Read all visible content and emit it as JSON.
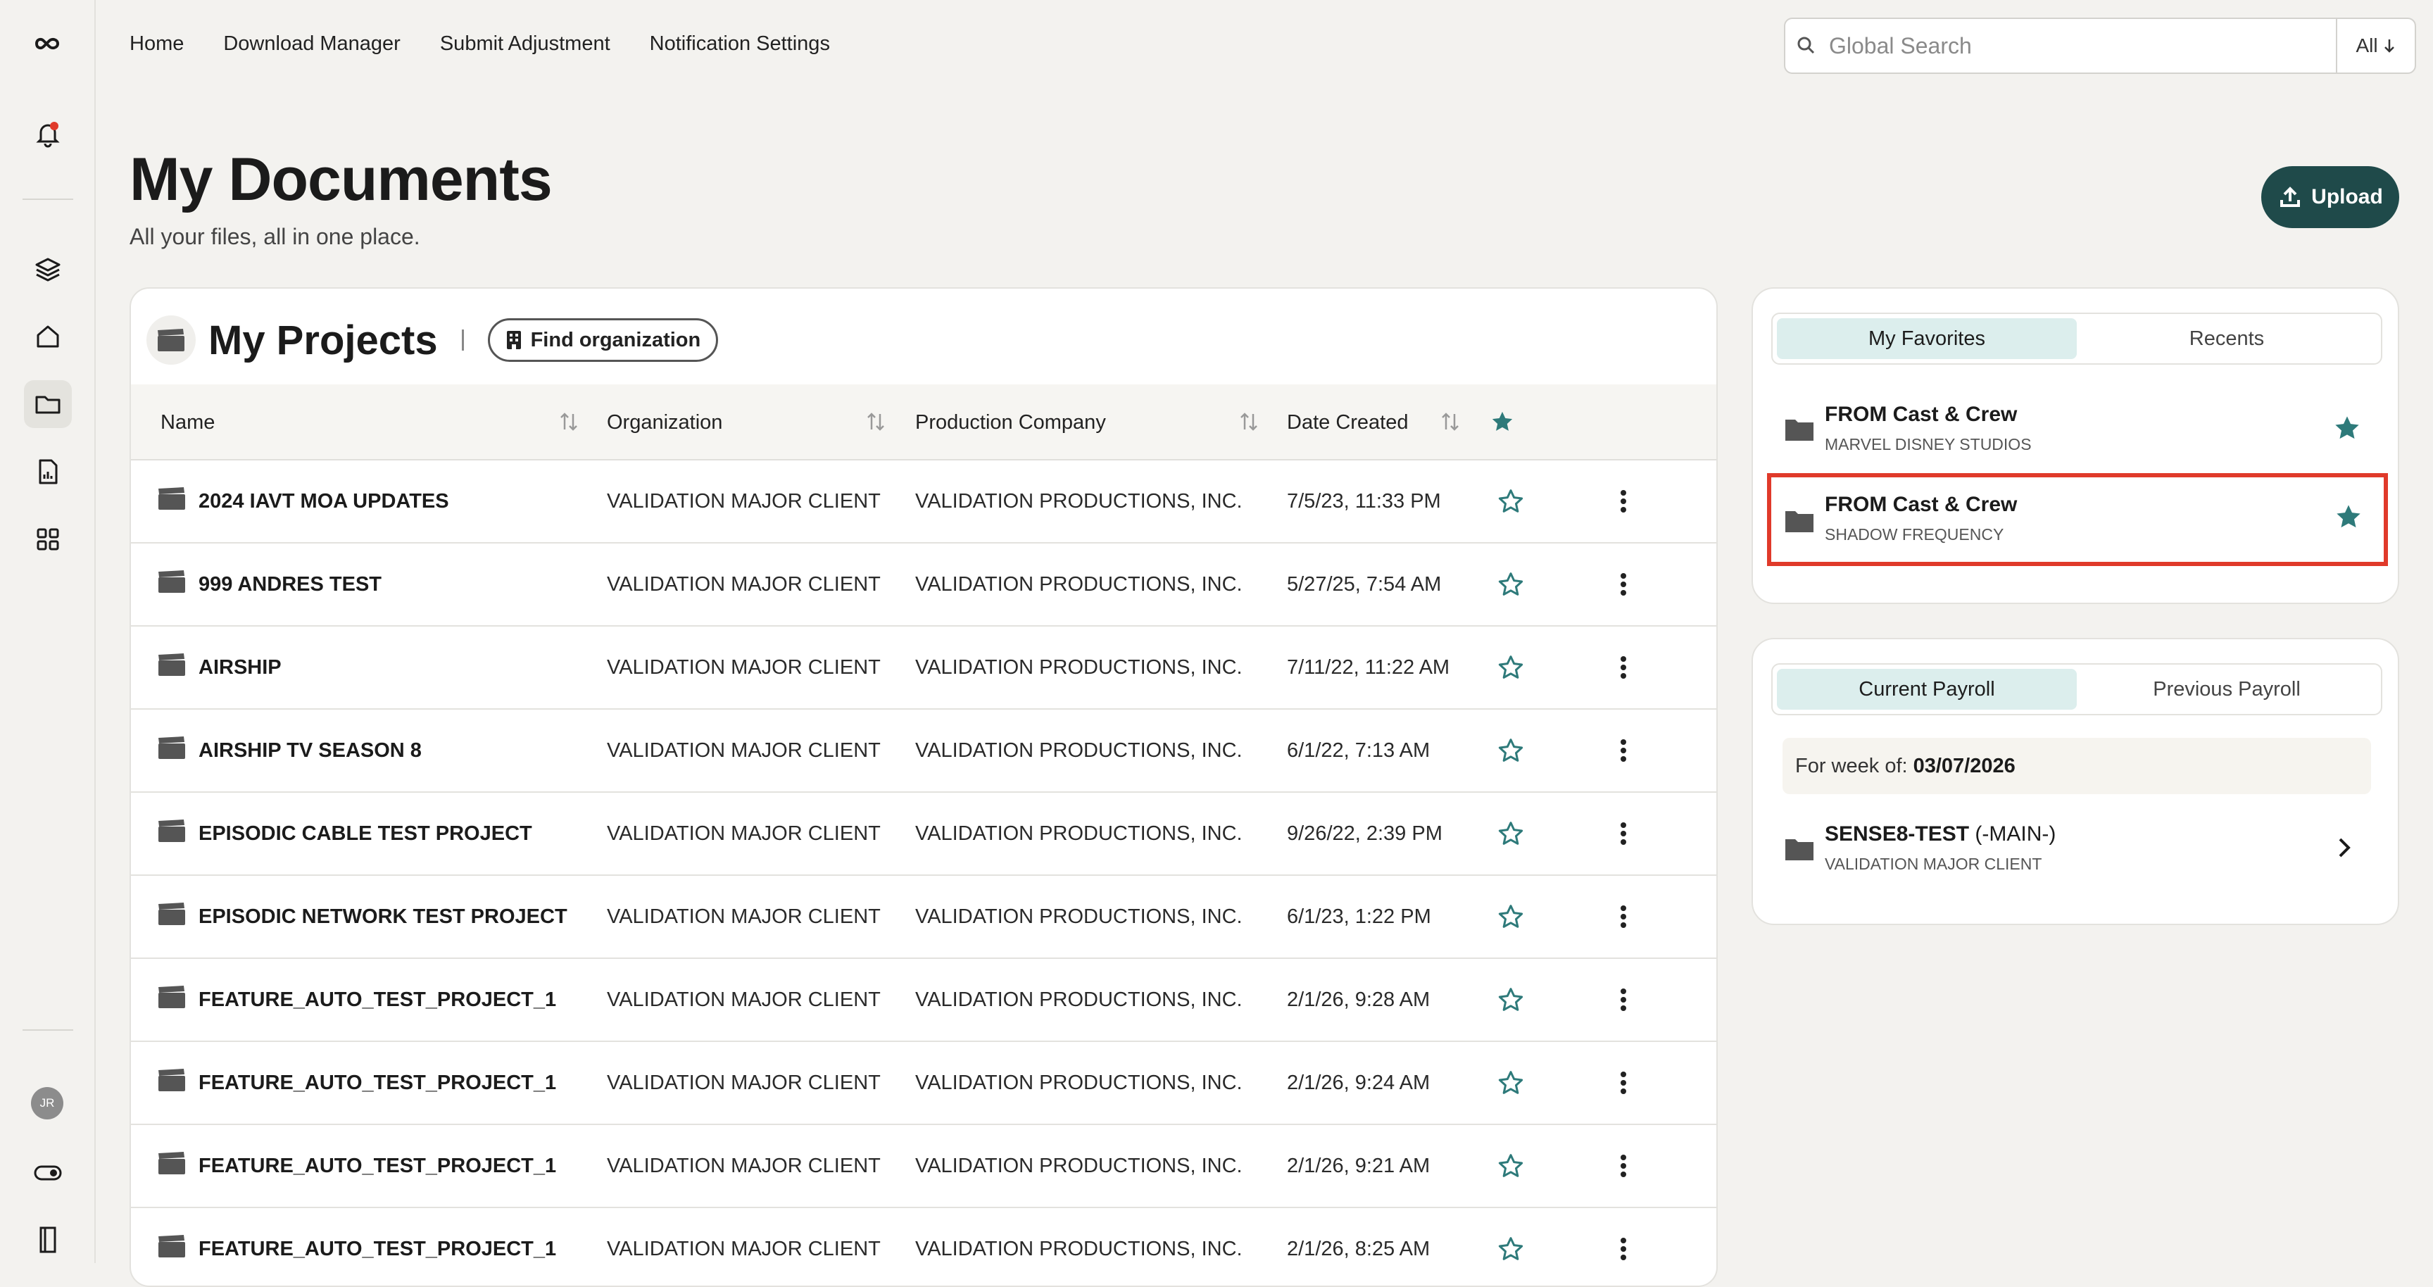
{
  "nav": {
    "home": "Home",
    "download_manager": "Download Manager",
    "submit_adjustment": "Submit Adjustment",
    "notification_settings": "Notification Settings"
  },
  "search": {
    "placeholder": "Global Search",
    "filter": "All"
  },
  "page": {
    "title": "My Documents",
    "subtitle": "All your files, all in one place.",
    "upload": "Upload"
  },
  "sidebar": {
    "avatar": "JR"
  },
  "projects": {
    "title": "My Projects",
    "find_org": "Find organization",
    "columns": {
      "name": "Name",
      "organization": "Organization",
      "company": "Production Company",
      "date": "Date Created"
    },
    "rows": [
      {
        "name": "2024 IAVT MOA UPDATES",
        "org": "VALIDATION MAJOR CLIENT",
        "company": "VALIDATION PRODUCTIONS, INC.",
        "date": "7/5/23, 11:33 PM"
      },
      {
        "name": "999 ANDRES TEST",
        "org": "VALIDATION MAJOR CLIENT",
        "company": "VALIDATION PRODUCTIONS, INC.",
        "date": "5/27/25, 7:54 AM"
      },
      {
        "name": "AIRSHIP",
        "org": "VALIDATION MAJOR CLIENT",
        "company": "VALIDATION PRODUCTIONS, INC.",
        "date": "7/11/22, 11:22 AM"
      },
      {
        "name": "AIRSHIP TV SEASON 8",
        "org": "VALIDATION MAJOR CLIENT",
        "company": "VALIDATION PRODUCTIONS, INC.",
        "date": "6/1/22, 7:13 AM"
      },
      {
        "name": "EPISODIC CABLE TEST PROJECT",
        "org": "VALIDATION MAJOR CLIENT",
        "company": "VALIDATION PRODUCTIONS, INC.",
        "date": "9/26/22, 2:39 PM"
      },
      {
        "name": "EPISODIC NETWORK TEST PROJECT",
        "org": "VALIDATION MAJOR CLIENT",
        "company": "VALIDATION PRODUCTIONS, INC.",
        "date": "6/1/23, 1:22 PM"
      },
      {
        "name": "FEATURE_AUTO_TEST_PROJECT_1",
        "org": "VALIDATION MAJOR CLIENT",
        "company": "VALIDATION PRODUCTIONS, INC.",
        "date": "2/1/26, 9:28 AM"
      },
      {
        "name": "FEATURE_AUTO_TEST_PROJECT_1",
        "org": "VALIDATION MAJOR CLIENT",
        "company": "VALIDATION PRODUCTIONS, INC.",
        "date": "2/1/26, 9:24 AM"
      },
      {
        "name": "FEATURE_AUTO_TEST_PROJECT_1",
        "org": "VALIDATION MAJOR CLIENT",
        "company": "VALIDATION PRODUCTIONS, INC.",
        "date": "2/1/26, 9:21 AM"
      },
      {
        "name": "FEATURE_AUTO_TEST_PROJECT_1",
        "org": "VALIDATION MAJOR CLIENT",
        "company": "VALIDATION PRODUCTIONS, INC.",
        "date": "2/1/26, 8:25 AM"
      }
    ]
  },
  "favorites": {
    "tabs": [
      "My Favorites",
      "Recents"
    ],
    "items": [
      {
        "title": "FROM Cast & Crew",
        "subtitle": "MARVEL DISNEY STUDIOS"
      },
      {
        "title": "FROM Cast & Crew",
        "subtitle": "SHADOW FREQUENCY"
      }
    ]
  },
  "payroll": {
    "tabs": [
      "Current Payroll",
      "Previous Payroll"
    ],
    "week_label": "For week of:",
    "week_value": "03/07/2026",
    "item": {
      "title": "SENSE8-TEST",
      "title_suffix": " (-MAIN-)",
      "subtitle": "VALIDATION MAJOR CLIENT"
    }
  },
  "colors": {
    "accent": "#1f4a4a",
    "star": "#2e7a7a",
    "highlight": "#e03a2a"
  }
}
